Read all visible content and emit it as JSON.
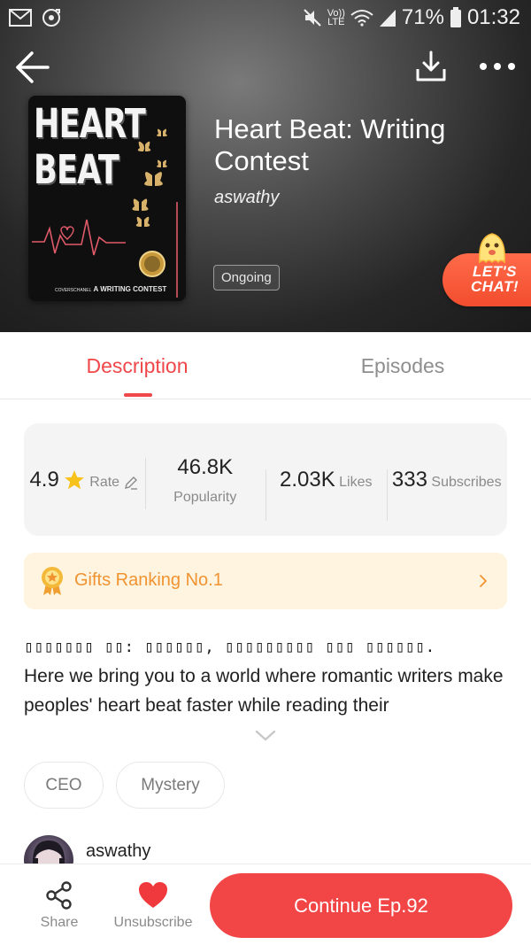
{
  "status_bar": {
    "left_icons": [
      "mail-icon",
      "sync-icon"
    ],
    "right_icons": [
      "mute-icon",
      "volte-icon",
      "wifi-icon",
      "signal-icon",
      "battery-icon"
    ],
    "volte_line1": "Vo))",
    "volte_line2": "LTE",
    "battery": "71%",
    "time": "01:32"
  },
  "top_actions": {
    "back_icon": "arrow-left-icon",
    "download_icon": "download-icon",
    "more_icon": "more-dots-icon"
  },
  "cover": {
    "title": "HEART\nBEAT",
    "subtitle_prefix": "COVERSCHANEL",
    "subtitle": "A WRITING CONTEST"
  },
  "book": {
    "title": "Heart Beat: Writing Contest",
    "author": "aswathy",
    "status": "Ongoing"
  },
  "chat_bubble": {
    "label": "LET'S CHAT!",
    "color": "#f24d2e"
  },
  "tabs": [
    {
      "label": "Description",
      "active": true
    },
    {
      "label": "Episodes",
      "active": false
    }
  ],
  "stats": [
    {
      "value": "4.9",
      "label": "Rate"
    },
    {
      "value": "46.8K",
      "label": "Popularity"
    },
    {
      "value": "2.03K",
      "label": "Likes"
    },
    {
      "value": "333",
      "label": "Subscribes"
    }
  ],
  "gifts": {
    "label": "Gifts Ranking No.1",
    "color": "#f09330"
  },
  "description": {
    "line1": "▯▯▯▯▯▯▯ ▯▯: ▯▯▯▯▯▯, ▯▯▯▯▯▯▯▯▯ ▯▯▯ ▯▯▯▯▯▯.",
    "body": "Here we bring you to a world where romantic writers make peoples' heart beat faster while reading their"
  },
  "tags": [
    "CEO",
    "Mystery"
  ],
  "author_row": {
    "name": "aswathy"
  },
  "bottom_bar": {
    "share": "Share",
    "unsubscribe": "Unsubscribe",
    "continue": "Continue Ep.92",
    "accent": "#f24646"
  },
  "colors": {
    "accent_red": "#f0474a",
    "inactive_tab": "#8e8e8e",
    "stats_bg": "#f4f4f4",
    "gifts_bg": "#fff4e0"
  }
}
